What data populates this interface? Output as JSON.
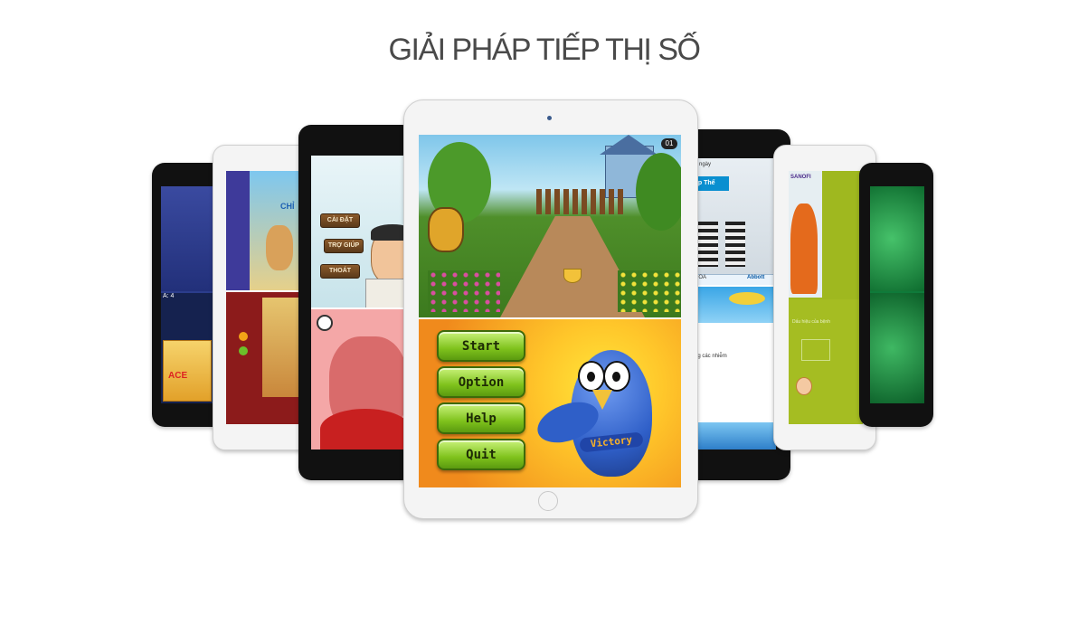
{
  "heading": "GIẢI PHÁP TIẾP THỊ SỐ",
  "center_tablet": {
    "level_badge": "01",
    "menu": {
      "start": "Start",
      "option": "Option",
      "help": "Help",
      "quit": "Quit"
    },
    "mascot_badge": "Victory"
  },
  "left_tablet_3": {
    "menu": [
      "CÀI ĐẶT",
      "TRỢ GIÚP",
      "THOÁT"
    ]
  },
  "left_tablet_2": {
    "side_text": "CHỈ"
  },
  "left_tablet_1": {
    "corner_text": "A: 4",
    "product_text": "ACE"
  },
  "right_tablet_3": {
    "top_text": "3 ngày",
    "tab_text": "ệp Thể",
    "bar_left": "ĐOA",
    "bar_right": "Abbott",
    "list_text": "ng các nhiễm"
  },
  "right_tablet_2": {
    "brand_text": "SANOFI",
    "small_text": "Dấu hiệu của bệnh"
  },
  "colors": {
    "title": "#4a4a4a",
    "button_green": "#7fc21c",
    "menu_bg_orange": "#f08a1c",
    "mascot_blue": "#2f5fc8"
  }
}
